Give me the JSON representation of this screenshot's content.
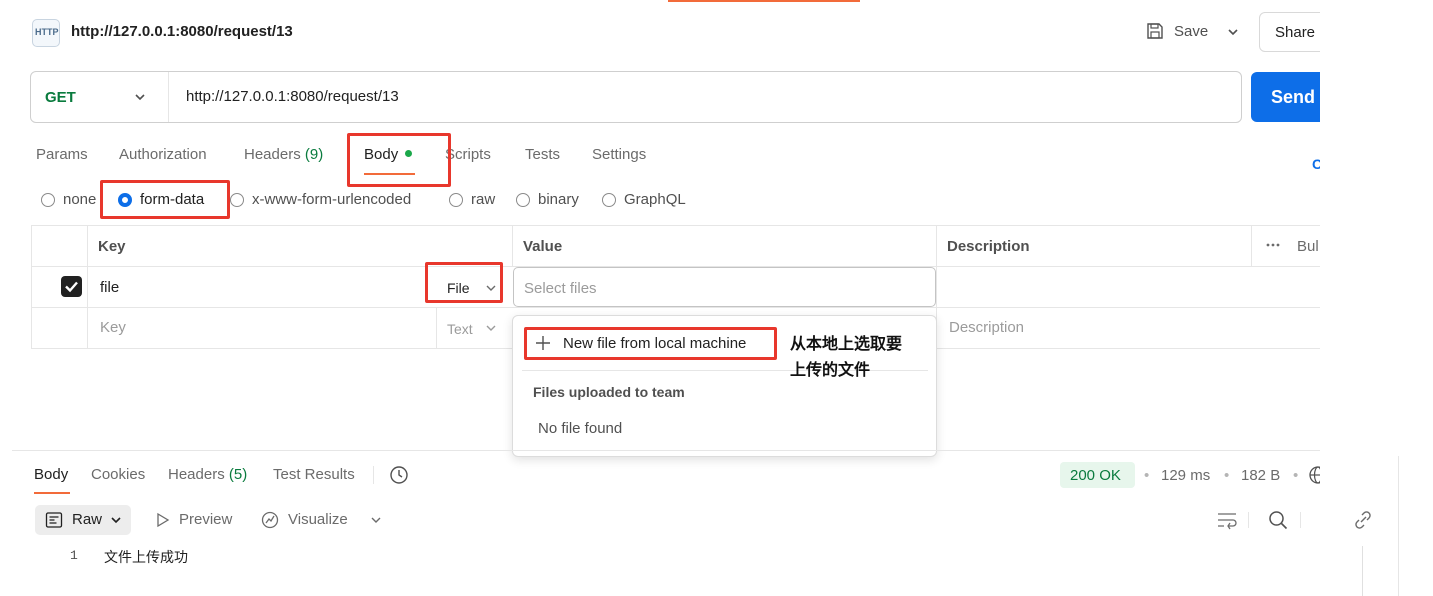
{
  "header": {
    "title": "http://127.0.0.1:8080/request/13",
    "icon_text": "HTTP",
    "save_label": "Save",
    "share_label": "Share"
  },
  "url_bar": {
    "method": "GET",
    "url": "http://127.0.0.1:8080/request/13",
    "send_label": "Send"
  },
  "request_tabs": [
    {
      "label": "Params"
    },
    {
      "label": "Authorization"
    },
    {
      "label": "Headers",
      "count": "(9)"
    },
    {
      "label": "Body",
      "active": true
    },
    {
      "label": "Scripts"
    },
    {
      "label": "Tests"
    },
    {
      "label": "Settings"
    }
  ],
  "cookies_edge": "C",
  "body_types": [
    {
      "label": "none",
      "selected": false
    },
    {
      "label": "form-data",
      "selected": true
    },
    {
      "label": "x-www-form-urlencoded",
      "selected": false
    },
    {
      "label": "raw",
      "selected": false
    },
    {
      "label": "binary",
      "selected": false
    },
    {
      "label": "GraphQL",
      "selected": false
    }
  ],
  "form_table": {
    "headers": {
      "key": "Key",
      "value": "Value",
      "description": "Description",
      "bulk": "Bul"
    },
    "rows": [
      {
        "checked": true,
        "key": "file",
        "type": "File",
        "value_placeholder": "Select files"
      }
    ],
    "new_row": {
      "key_placeholder": "Key",
      "type": "Text",
      "description_placeholder": "Description"
    }
  },
  "file_dropdown": {
    "new_file_label": "New file from local machine",
    "section_title": "Files uploaded to team",
    "empty_text": "No file found"
  },
  "annotation": {
    "line1": "从本地上选取要",
    "line2": "上传的文件"
  },
  "response": {
    "tabs": [
      {
        "label": "Body",
        "active": true
      },
      {
        "label": "Cookies"
      },
      {
        "label": "Headers",
        "count": "(5)"
      },
      {
        "label": "Test Results"
      }
    ],
    "status": "200 OK",
    "time": "129 ms",
    "size": "182 B",
    "view_mode": "Raw",
    "preview_label": "Preview",
    "visualize_label": "Visualize",
    "lines": [
      {
        "no": "1",
        "text": "文件上传成功"
      }
    ]
  },
  "colors": {
    "accent_orange": "#f26b3a",
    "send_blue": "#0d6ee8",
    "method_green": "#0a7b3e",
    "annotation_red": "#e8372c"
  },
  "icons": [
    "http-icon",
    "save-icon",
    "chevron-down-icon",
    "more-icon",
    "history-icon",
    "globe-icon",
    "preview-icon",
    "visualize-icon",
    "wrap-icon",
    "search-icon",
    "copy-icon",
    "link-icon",
    "plus-icon",
    "raw-icon"
  ]
}
